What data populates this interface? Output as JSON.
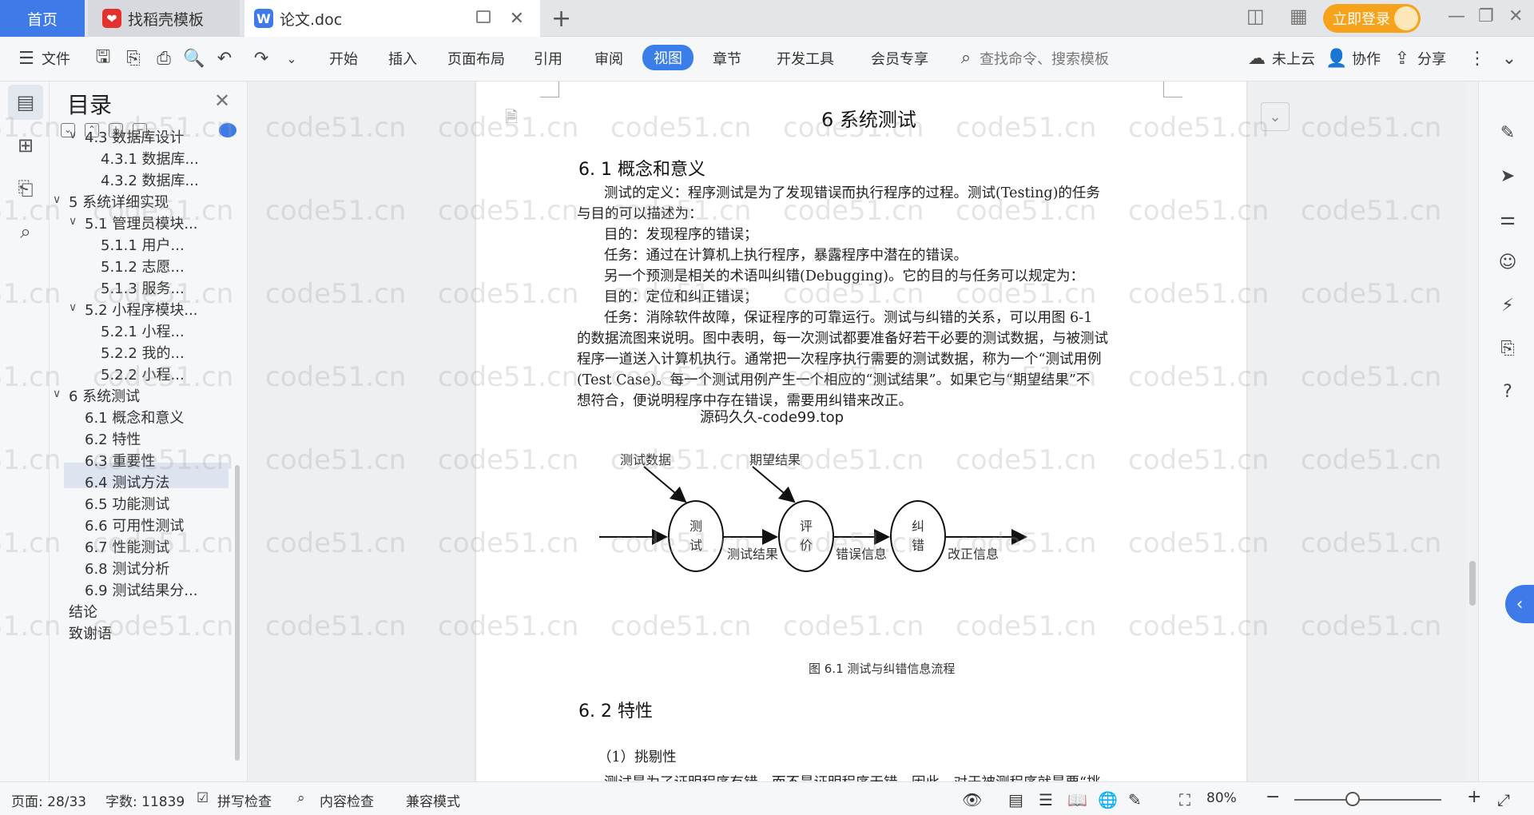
{
  "tabs": {
    "home": "首页",
    "daoke": "找稻壳模板",
    "doc": "论文.doc",
    "new_tab": "+"
  },
  "header": {
    "login": "立即登录"
  },
  "menu": {
    "file": "文件",
    "items": [
      "开始",
      "插入",
      "页面布局",
      "引用",
      "审阅",
      "视图",
      "章节",
      "开发工具",
      "会员专享"
    ],
    "active": "视图",
    "search_placeholder": "查找命令、搜索模板",
    "cloud": "未上云",
    "collab": "协作",
    "share": "分享"
  },
  "toc": {
    "title": "目录",
    "items": [
      {
        "text": "4.3 数据库设计",
        "level": 2,
        "arrow": "∨"
      },
      {
        "text": "4.3.1 数据库...",
        "level": 3
      },
      {
        "text": "4.3.2 数据库...",
        "level": 3
      },
      {
        "text": "5 系统详细实现",
        "level": 1,
        "arrow": "∨"
      },
      {
        "text": "5.1 管理员模块...",
        "level": 2,
        "arrow": "∨"
      },
      {
        "text": "5.1.1 用户...",
        "level": 3
      },
      {
        "text": "5.1.2 志愿...",
        "level": 3
      },
      {
        "text": "5.1.3 服务...",
        "level": 3
      },
      {
        "text": "5.2 小程序模块...",
        "level": 2,
        "arrow": "∨"
      },
      {
        "text": "5.2.1 小程...",
        "level": 3
      },
      {
        "text": "5.2.2 我的...",
        "level": 3
      },
      {
        "text": "5.2.2 小程...",
        "level": 3
      },
      {
        "text": "6 系统测试",
        "level": 1,
        "arrow": "∨",
        "selected": true
      },
      {
        "text": "6.1 概念和意义",
        "level": 2
      },
      {
        "text": "6.2 特性",
        "level": 2
      },
      {
        "text": "6.3 重要性",
        "level": 2
      },
      {
        "text": "6.4 测试方法",
        "level": 2
      },
      {
        "text": "6.5 功能测试",
        "level": 2
      },
      {
        "text": "6.6 可用性测试",
        "level": 2
      },
      {
        "text": "6.7 性能测试",
        "level": 2
      },
      {
        "text": "6.8 测试分析",
        "level": 2
      },
      {
        "text": "6.9 测试结果分...",
        "level": 2
      },
      {
        "text": "结论",
        "level": 1
      },
      {
        "text": "致谢语",
        "level": 1
      }
    ]
  },
  "document": {
    "chapter_title": "6 系统测试",
    "section1_title": "6. 1 概念和意义",
    "paragraphs": [
      "测试的定义：程序测试是为了发现错误而执行程序的过程。测试(Testing)的任务",
      "与目的可以描述为：",
      "目的：发现程序的错误；",
      "任务：通过在计算机上执行程序，暴露程序中潜在的错误。",
      "另一个预测是相关的术语叫纠错(Debugging)。它的目的与任务可以规定为：",
      "目的：定位和纠正错误；",
      "任务：消除软件故障，保证程序的可靠运行。测试与纠错的关系，可以用图 6-1",
      "的数据流图来说明。图中表明，每一次测试都要准备好若干必要的测试数据，与被测试",
      "程序一道送入计算机执行。通常把一次程序执行需要的测试数据，称为一个“测试用例",
      "(Test Case)。每一个测试用例产生一个相应的“测试结果”。如果它与“期望结果”不",
      "想符合，便说明程序中存在错误，需要用纠错来改正。"
    ],
    "overlay_watermark": "源码久久-code99.top",
    "diagram": {
      "input_top_left": "测试数据",
      "input_top_right": "期望结果",
      "node1": [
        "测",
        "试"
      ],
      "node2": [
        "评",
        "价"
      ],
      "node3": [
        "纠",
        "错"
      ],
      "edge1": "测试结果",
      "edge2": "错误信息",
      "edge3": "改正信息"
    },
    "figure_caption": "图 6.1 测试与纠错信息流程",
    "section2_title": "6. 2 特性",
    "item1": "（1）挑剔性",
    "cut_line": "测试是为了证明程序有错，而不是证明程序无错。因此，对于被测程序就是要“挑"
  },
  "watermark": "code51.cn",
  "status": {
    "page": "页面: 28/33",
    "words": "字数: 11839",
    "spell": "拼写检查",
    "content_check": "内容检查",
    "compat": "兼容模式",
    "zoom": "80%"
  },
  "colors": {
    "accent": "#3f7be8",
    "login": "#f7a21b"
  }
}
